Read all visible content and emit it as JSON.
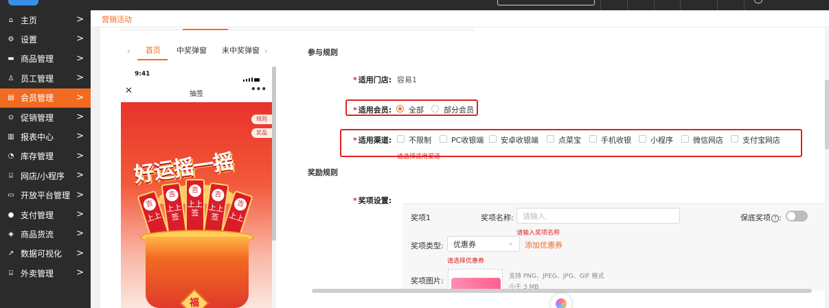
{
  "sidebar": {
    "items": [
      {
        "label": "主页",
        "icon": "home-icon",
        "glyph": "⌂"
      },
      {
        "label": "设置",
        "icon": "gear-icon",
        "glyph": "⚙"
      },
      {
        "label": "商品管理",
        "icon": "goods-icon",
        "glyph": "▬"
      },
      {
        "label": "员工管理",
        "icon": "staff-icon",
        "glyph": "♙"
      },
      {
        "label": "会员管理",
        "icon": "member-icon",
        "glyph": "▤"
      },
      {
        "label": "促销管理",
        "icon": "promotion-icon",
        "glyph": "⊙"
      },
      {
        "label": "报表中心",
        "icon": "report-icon",
        "glyph": "▥"
      },
      {
        "label": "库存管理",
        "icon": "inventory-icon",
        "glyph": "◔"
      },
      {
        "label": "网店/小程序",
        "icon": "shop-icon",
        "glyph": "⌸"
      },
      {
        "label": "开放平台管理",
        "icon": "monitor-icon",
        "glyph": "▭"
      },
      {
        "label": "支付管理",
        "icon": "pay-icon",
        "glyph": "●"
      },
      {
        "label": "商品货流",
        "icon": "logistics-icon",
        "glyph": "◈"
      },
      {
        "label": "数据可视化",
        "icon": "chart-icon",
        "glyph": "↗"
      },
      {
        "label": "外卖管理",
        "icon": "delivery-icon",
        "glyph": "⌸"
      }
    ],
    "active_index": 4,
    "arrow": ">"
  },
  "breadcrumb": {
    "tab": "营销活动"
  },
  "preview": {
    "tabs": [
      "首页",
      "中奖弹窗",
      "未中奖弹窗"
    ],
    "active_tab": 0,
    "prev": "‹",
    "next": "›",
    "time": "9:41",
    "title": "抽签",
    "close": "✕",
    "more": "•••",
    "side_tags": [
      "规则",
      "奖品"
    ],
    "slogan": "好运摇一摇",
    "stick_top": "吉",
    "stick_text": [
      "上上签",
      "上上签",
      "上上签",
      "上上签",
      "上上",
      "上上"
    ],
    "fu": "福"
  },
  "rules": {
    "section_title": "参与规则",
    "store_label": "适用门店:",
    "store_value": "容易1",
    "member_label": "适用会员:",
    "member_options": [
      "全部",
      "部分会员"
    ],
    "member_selected": 0,
    "channel_label": "适用渠道:",
    "channel_options": [
      "不限制",
      "PC收银端",
      "安卓收银端",
      "点菜宝",
      "手机收银",
      "小程序",
      "微信网店",
      "支付宝网店"
    ],
    "channel_hint": "请选择适用渠道",
    "required_mark": "*"
  },
  "prize": {
    "section_title": "奖励规则",
    "setting_label": "奖项设置:",
    "item_title": "奖项1",
    "name_label": "奖项名称:",
    "name_placeholder": "请输入",
    "name_hint": "请输入奖项名称",
    "guarantee_label": "保底奖项",
    "guarantee_on": false,
    "type_label": "奖项类型:",
    "type_value": "优惠券",
    "add_coupon": "添加优惠券",
    "type_hint": "请选择优惠券",
    "image_label": "奖项图片:",
    "image_hint_1": "支持 PNG、JPEG、JPG、GIF 格式",
    "image_hint_2": "小于 3 MB"
  },
  "colors": {
    "accent": "#f26b22",
    "sidebar_bg": "#2b2b2b",
    "highlight": "#e0201c",
    "error": "#e02020"
  }
}
